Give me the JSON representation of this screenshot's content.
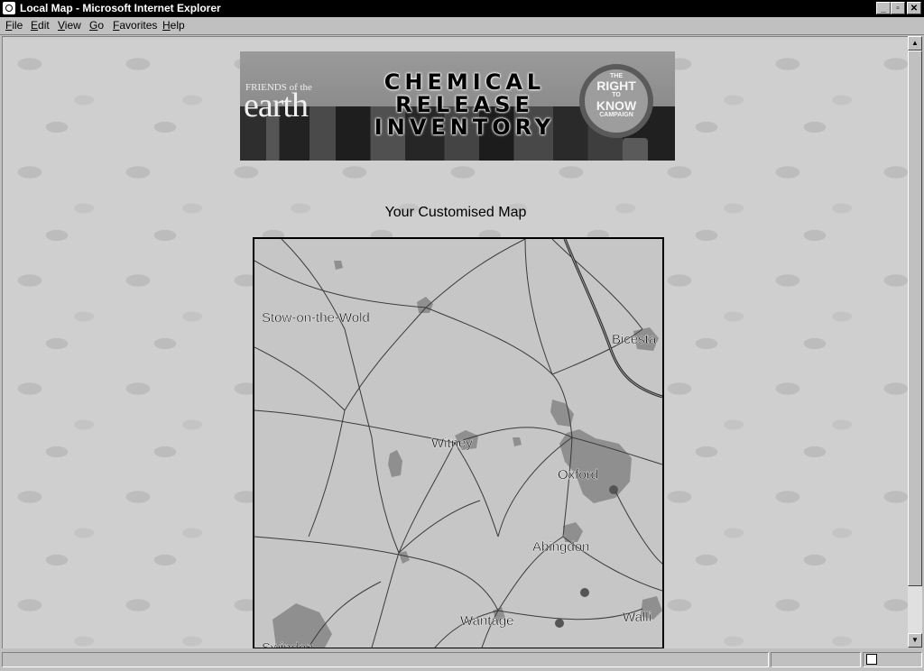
{
  "window": {
    "title": "Local Map - Microsoft Internet Explorer",
    "icon": "ie-logo-icon",
    "controls": {
      "minimize": "_",
      "maximize": "▫",
      "close": "✕"
    }
  },
  "menu": {
    "items": [
      {
        "label": "File"
      },
      {
        "label": "Edit"
      },
      {
        "label": "View"
      },
      {
        "label": "Go"
      },
      {
        "label": "Favorites"
      },
      {
        "label": "Help"
      }
    ]
  },
  "banner": {
    "org_line1": "FRIENDS of the",
    "org_line2": "earth",
    "title_lines": [
      "CHEMICAL",
      "RELEASE",
      "INVENTORY"
    ],
    "campaign_lines": [
      "THE",
      "RIGHT",
      "TO",
      "KNOW",
      "CAMPAIGN"
    ]
  },
  "page": {
    "title": "Your Customised Map"
  },
  "map": {
    "towns": [
      {
        "name": "Stow-on-the-Wold"
      },
      {
        "name": "Bicesta"
      },
      {
        "name": "Witney"
      },
      {
        "name": "Oxford"
      },
      {
        "name": "Abingdon"
      },
      {
        "name": "Wantage"
      },
      {
        "name": "Walli"
      },
      {
        "name": "Swindon"
      }
    ]
  },
  "colors": {
    "titlebar": "#000000",
    "chrome": "#c0c0c0",
    "map_land": "#c6c6c6",
    "urban": "#8f8f8f",
    "road": "#3a3a3a"
  }
}
